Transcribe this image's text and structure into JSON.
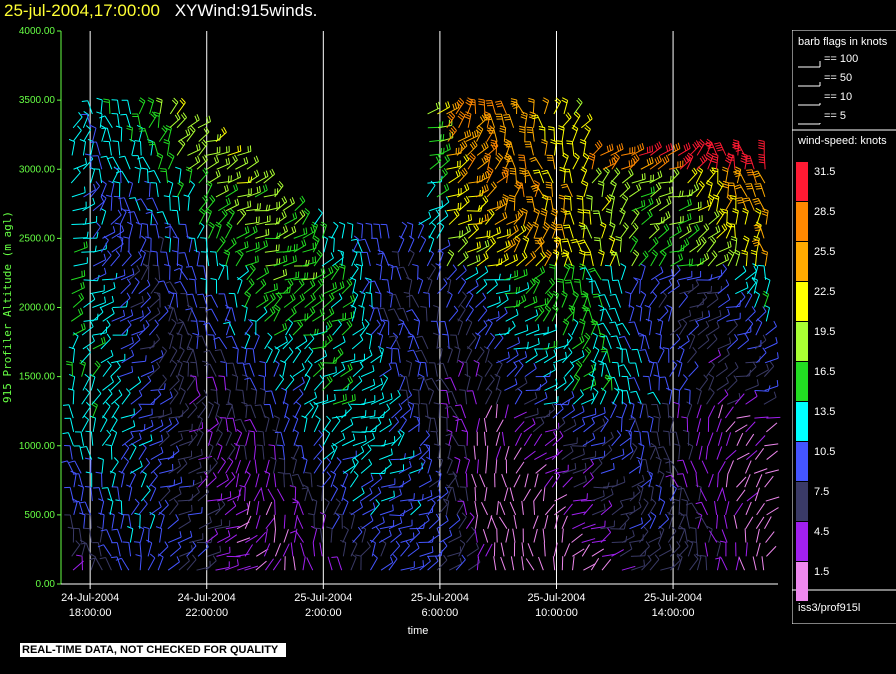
{
  "header": {
    "datetime": "25-jul-2004,17:00:00",
    "product": "XYWind:915winds."
  },
  "chart_data": {
    "type": "wind-barb time-height",
    "xlabel": "time",
    "ylabel": "915 Profiler Altitude (m agl)",
    "ylim": [
      0,
      4000
    ],
    "yticks": [
      "0.00",
      "500.00",
      "1000.00",
      "1500.00",
      "2000.00",
      "2500.00",
      "3000.00",
      "3500.00",
      "4000.00"
    ],
    "xticks": [
      {
        "date": "24-Jul-2004",
        "time": "18:00:00",
        "hours": 18
      },
      {
        "date": "24-Jul-2004",
        "time": "22:00:00",
        "hours": 22
      },
      {
        "date": "25-Jul-2004",
        "time": "2:00:00",
        "hours": 26
      },
      {
        "date": "25-Jul-2004",
        "time": "6:00:00",
        "hours": 30
      },
      {
        "date": "25-Jul-2004",
        "time": "10:00:00",
        "hours": 34
      },
      {
        "date": "25-Jul-2004",
        "time": "14:00:00",
        "hours": 38
      }
    ],
    "xlim_hours": [
      17,
      41.6
    ],
    "barb_legend": {
      "title": "barb flags in knots",
      "items": [
        "== 100",
        "== 50",
        "== 10",
        "== 5"
      ]
    },
    "colorbar": {
      "title": "wind-speed: knots",
      "levels": [
        "31.5",
        "28.5",
        "25.5",
        "22.5",
        "19.5",
        "16.5",
        "13.5",
        "10.5",
        "7.5",
        "4.5",
        "1.5"
      ],
      "colors": [
        "#ff1a33",
        "#ff8800",
        "#ffaa00",
        "#ffff00",
        "#aaff33",
        "#22dd22",
        "#00ffff",
        "#4455ff",
        "#3a3a66",
        "#a020f0",
        "#ee88ee"
      ]
    },
    "source": "iss3/prof915l"
  },
  "footer": {
    "qc_note": "REAL-TIME DATA, NOT CHECKED FOR QUALITY"
  }
}
